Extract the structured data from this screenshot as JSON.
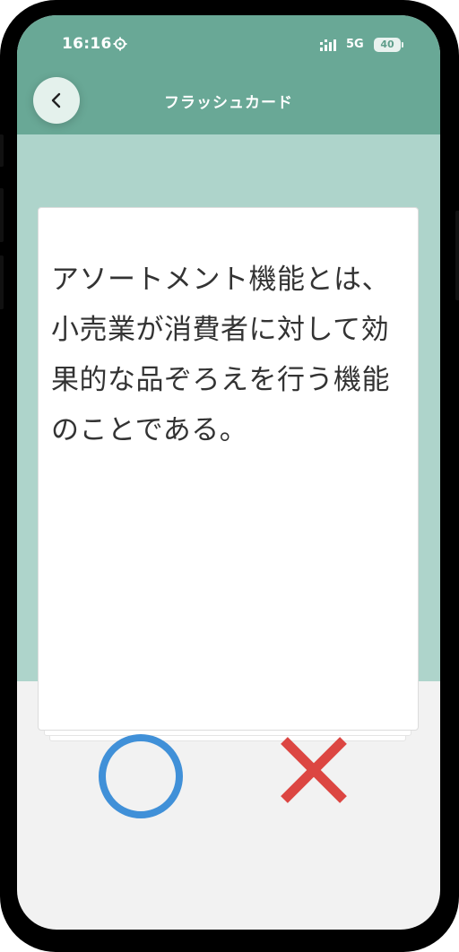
{
  "status_bar": {
    "time": "16:16",
    "network": "5G",
    "battery": "40",
    "icons": [
      "gear-icon",
      "signal-icon"
    ]
  },
  "header": {
    "title": "フラッシュカード",
    "back_icon": "chevron-left-icon"
  },
  "card": {
    "text": "アソートメント機能とは、小売業が消費者に対して効果的な品ぞろえを行う機能のことである。"
  },
  "answer_buttons": {
    "correct_icon": "circle-o-icon",
    "incorrect_icon": "cross-x-icon"
  },
  "colors": {
    "header": "#69a896",
    "band": "#aed4cb",
    "correct": "#4090d8",
    "incorrect": "#dc4642",
    "background": "#f2f2f2"
  }
}
